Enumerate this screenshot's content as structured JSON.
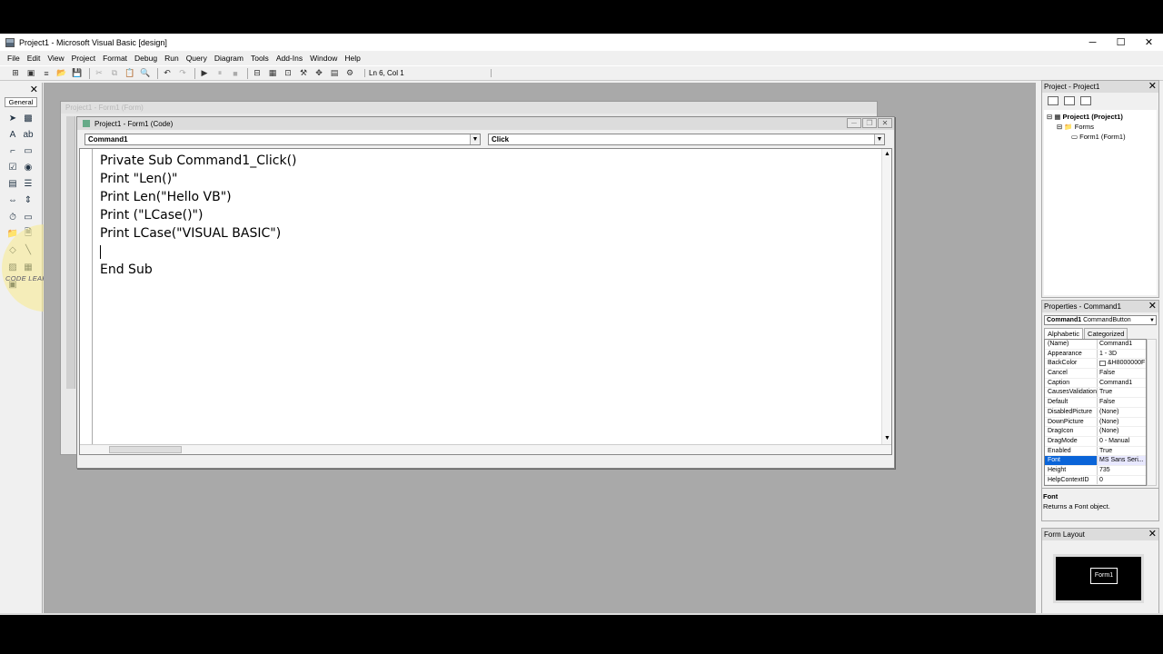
{
  "window": {
    "title": "Project1 - Microsoft Visual Basic [design]",
    "controls": {
      "minimize": "─",
      "maximize": "☐",
      "close": "✕"
    }
  },
  "menu": [
    "File",
    "Edit",
    "View",
    "Project",
    "Format",
    "Debug",
    "Run",
    "Query",
    "Diagram",
    "Tools",
    "Add-Ins",
    "Window",
    "Help"
  ],
  "toolbar": {
    "position_label": "Ln 6, Col 1"
  },
  "toolbox": {
    "tab_label": "General",
    "close": "✕",
    "watermark": "CODE LEARNING"
  },
  "form_window": {
    "title": "Project1 - Form1 (Form)"
  },
  "code_window": {
    "title": "Project1 - Form1 (Code)",
    "object_combo": "Command1",
    "procedure_combo": "Click",
    "lines": [
      "Private Sub Command1_Click()",
      "Print \"Len()\"",
      "Print Len(\"Hello VB\")",
      "Print (\"LCase()\")",
      "Print LCase(\"VISUAL BASIC\")",
      "",
      "End Sub"
    ]
  },
  "project_explorer": {
    "title": "Project - Project1",
    "root": "Project1 (Project1)",
    "folder": "Forms",
    "item": "Form1 (Form1)"
  },
  "properties": {
    "title": "Properties - Command1",
    "object_name": "Command1",
    "object_type": "CommandButton",
    "tabs": [
      "Alphabetic",
      "Categorized"
    ],
    "rows": [
      {
        "name": "(Name)",
        "value": "Command1"
      },
      {
        "name": "Appearance",
        "value": "1 - 3D"
      },
      {
        "name": "BackColor",
        "value": "&H8000000F"
      },
      {
        "name": "Cancel",
        "value": "False"
      },
      {
        "name": "Caption",
        "value": "Command1"
      },
      {
        "name": "CausesValidation",
        "value": "True"
      },
      {
        "name": "Default",
        "value": "False"
      },
      {
        "name": "DisabledPicture",
        "value": "(None)"
      },
      {
        "name": "DownPicture",
        "value": "(None)"
      },
      {
        "name": "DragIcon",
        "value": "(None)"
      },
      {
        "name": "DragMode",
        "value": "0 - Manual"
      },
      {
        "name": "Enabled",
        "value": "True"
      },
      {
        "name": "Font",
        "value": "MS Sans Seri..."
      },
      {
        "name": "Height",
        "value": "735"
      },
      {
        "name": "HelpContextID",
        "value": "0"
      }
    ],
    "selected_row": 12,
    "description_title": "Font",
    "description_text": "Returns a Font object."
  },
  "form_layout": {
    "title": "Form Layout",
    "form_label": "Form1"
  }
}
